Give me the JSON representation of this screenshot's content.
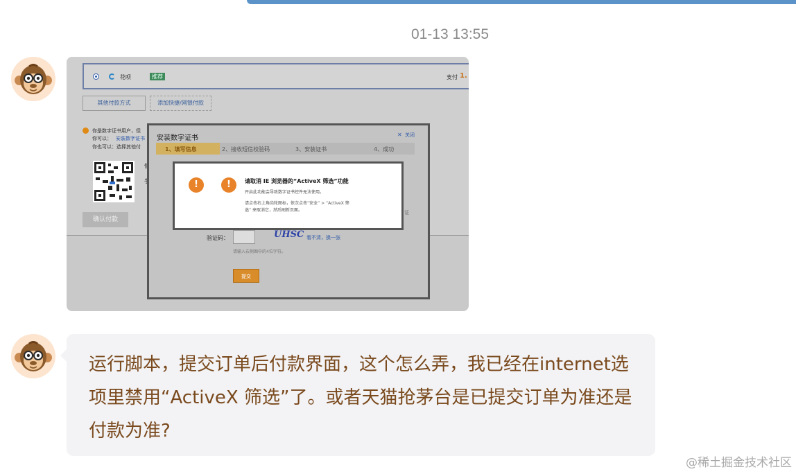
{
  "timestamp": "01-13 13:55",
  "screenshot": {
    "payment_method_label": "花呗",
    "recommend_badge": "推荐",
    "pay_label": "支付",
    "pay_amount": "1.",
    "other_payment_button": "其他付款方式",
    "add_quick_payment_button": "添加快捷/网银付款",
    "cert_notice": "你是数字证书用户，但",
    "you_can_label": "你可以：",
    "install_cert_link": "安装数字证书",
    "also_can_label": "你也可以：选择其他付",
    "side_text_1": "使",
    "side_text_2": "手",
    "confirm_pay_button": "确认付款",
    "dialog": {
      "title": "安装数字证书",
      "close_label": "关闭",
      "steps": [
        "1、填写信息",
        "2、接收短信校验码",
        "3、安装证书",
        "4、成功"
      ],
      "captcha_label": "验证码：",
      "captcha_image_text": "UHSC",
      "captcha_refresh": "看不清，换一张",
      "captcha_hint": "请输入右侧图中的4位字符。",
      "submit_button": "提交",
      "side_text": "证"
    },
    "alert": {
      "title": "请取消 IE 浏览器的“ActiveX 筛选”功能",
      "line1": "开启此功能会导致数字证书控件无法使用。",
      "line2": "请点击右上角齿轮图标，依次点击“安全” > “ActiveX 筛",
      "line3": "选” 来取消它，然后刷新页面。"
    }
  },
  "message_text": "运行脚本，提交订单后付款界面，这个怎么弄，我已经在internet选项里禁用“ActiveX 筛选”了。或者天猫抢茅台是已提交订单为准还是付款为准?",
  "watermark": "@稀土掘金技术社区",
  "colors": {
    "bubble_bg": "#f3f3f5",
    "message_text": "#7a4a1e",
    "timestamp": "#8a8a8a",
    "top_bubble": "#5b93c8"
  }
}
